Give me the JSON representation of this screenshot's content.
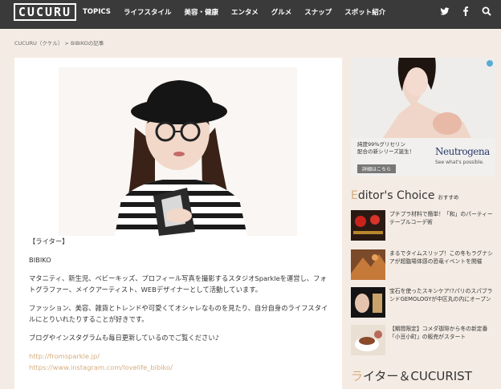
{
  "header": {
    "logo": "CUCURU",
    "nav": [
      "TOPICS",
      "ライフスタイル",
      "美容・健康",
      "エンタメ",
      "グルメ",
      "スナップ",
      "スポット紹介"
    ]
  },
  "breadcrumb": "CUCURU（クケル） > BIBIKOの記事",
  "article": {
    "heading": "【ライター】",
    "name": "BIBIKO",
    "para1": "マタニティ、新生児、ベビーキッズ、プロフィール写真を撮影するスタジオSparkleを運営し、フォトグラファー、メイクアーティスト、WEBデザイナーとして活動しています。",
    "para2": "ファッション、美容、雑貨とトレンドや可愛くてオシャレなものを見たり、自分自身のライフスタイルにとりいれたりすることが好きです。",
    "para3": "ブログやインスタグラムも毎日更新しているのでご覧ください♪",
    "link1": "http://fromsparkle.jp/",
    "link2": "https://www.instagram.com/lovelife_bibiko/"
  },
  "ad": {
    "line1": "純度99%グリセリン",
    "line2": "配合の新シリーズ誕生！",
    "button": "詳細はこちら",
    "brand": "Neutrogena",
    "tagline": "See what's possible."
  },
  "editors_choice": {
    "title_first": "E",
    "title_rest": "ditor's Choice",
    "subtitle": "おすすめ",
    "items": [
      {
        "text": "プチプラ材料で簡単！「和」のパーティーテーブルコーデ術"
      },
      {
        "text": "まるでタイムスリップ！この冬もラグナシアが超臨場体感の恐竜イベントを開催"
      },
      {
        "text": "宝石を使ったスキンケア!?パリのスパブランドGEMOLOGYが中区丸の内にオープン"
      },
      {
        "text": "【期間限定】コメダ珈琲から冬の新定番「小豆小町」の販売がスタート"
      }
    ]
  },
  "writers": {
    "title_first": "ラ",
    "title_rest": "イター＆CUCURIST"
  }
}
